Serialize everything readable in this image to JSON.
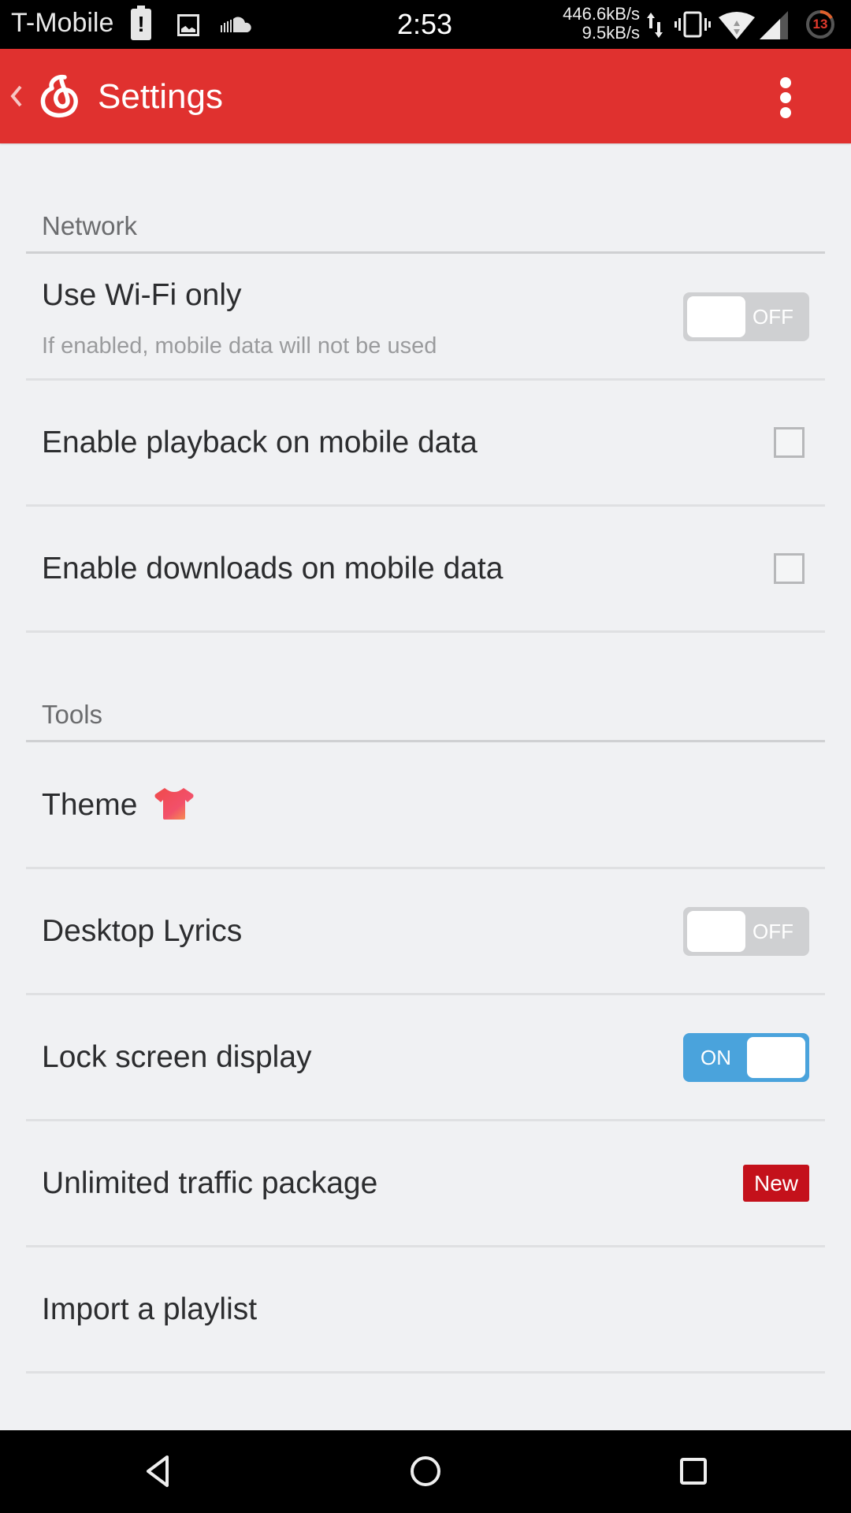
{
  "status_bar": {
    "carrier": "T-Mobile",
    "time": "2:53",
    "download_speed": "446.6kB/s",
    "upload_speed": "9.5kB/s",
    "notification_count": "13",
    "icons": [
      "battery-alert-icon",
      "gallery-icon",
      "soundcloud-icon",
      "data-arrows-icon",
      "vibrate-icon",
      "wifi-icon",
      "cell-signal-icon",
      "notification-counter-icon"
    ]
  },
  "app_bar": {
    "title": "Settings",
    "back_icon": "chevron-left-icon",
    "logo_icon": "netease-music-logo-icon",
    "menu_icon": "more-vertical-icon",
    "color": "#e0312f"
  },
  "sections": [
    {
      "title": "Network",
      "items": [
        {
          "label": "Use Wi-Fi only",
          "subtitle": "If enabled, mobile data will not be used",
          "control": "toggle",
          "state": "OFF"
        },
        {
          "label": "Enable playback on mobile data",
          "control": "checkbox",
          "checked": false
        },
        {
          "label": "Enable downloads on mobile data",
          "control": "checkbox",
          "checked": false
        }
      ]
    },
    {
      "title": "Tools",
      "items": [
        {
          "label": "Theme",
          "icon": "tshirt-icon"
        },
        {
          "label": "Desktop Lyrics",
          "control": "toggle",
          "state": "OFF"
        },
        {
          "label": "Lock screen display",
          "control": "toggle",
          "state": "ON"
        },
        {
          "label": "Unlimited traffic package",
          "badge": "New"
        },
        {
          "label": "Import a playlist"
        }
      ]
    }
  ],
  "colors": {
    "toggle_on": "#4aa3dc",
    "toggle_off": "#cfd0d2",
    "badge": "#c4111b",
    "background": "#f0f1f3"
  },
  "nav_bar": {
    "buttons": [
      "back",
      "home",
      "recents"
    ]
  }
}
